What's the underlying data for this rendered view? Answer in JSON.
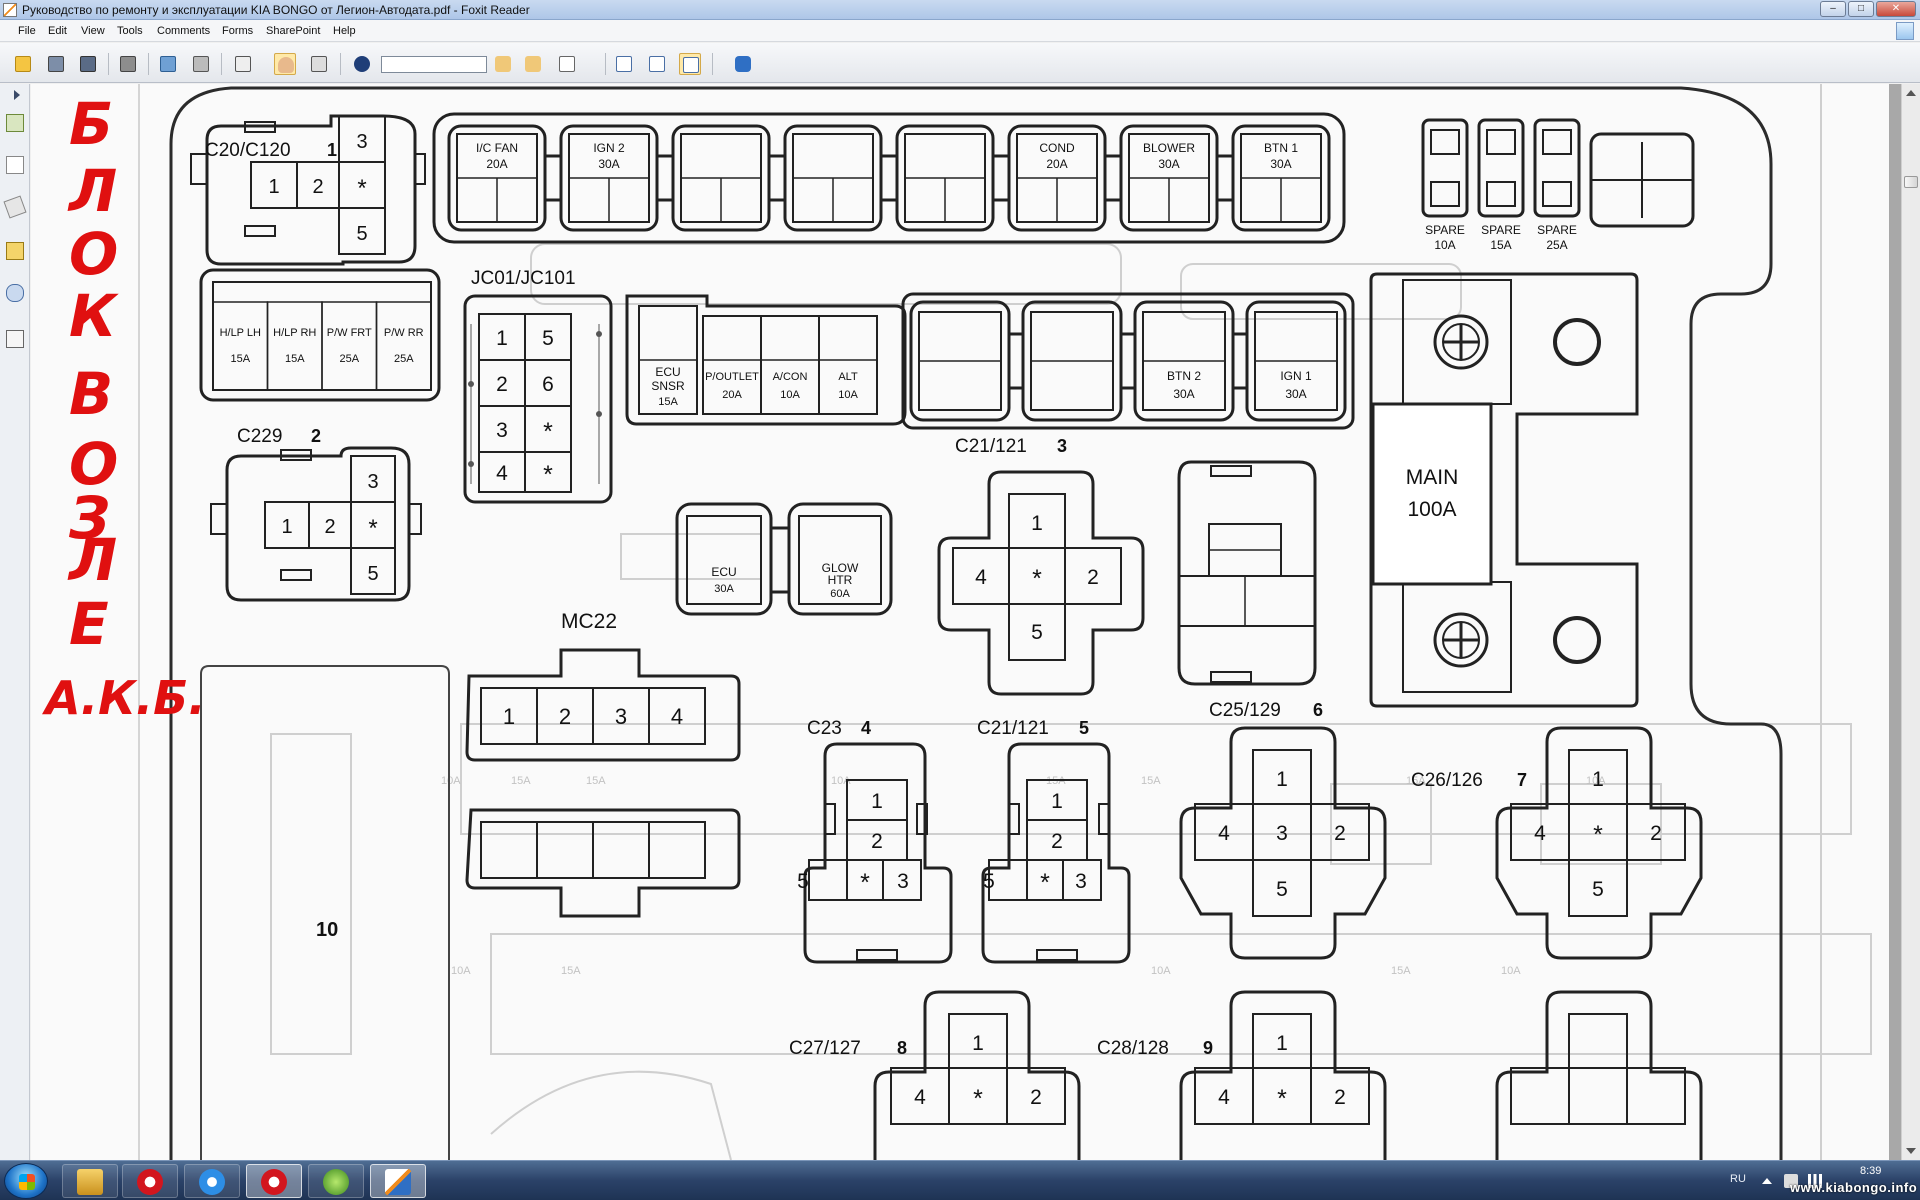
{
  "window": {
    "title": "Руководство по ремонту и эксплуатации KIA BONGO от Легион-Автодата.pdf - Foxit Reader",
    "minimize": "–",
    "maximize": "□",
    "close": "✕"
  },
  "menu": [
    "File",
    "Edit",
    "View",
    "Tools",
    "Comments",
    "Forms",
    "SharePoint",
    "Help"
  ],
  "toolbar": {
    "icons": [
      "open-icon",
      "save-icon",
      "save-as-icon",
      "print-icon",
      "email-icon",
      "scan-icon",
      "select-text-icon",
      "hand-tool-icon",
      "snapshot-icon",
      "find-icon",
      "prev-result-icon",
      "next-result-icon",
      "highlight-icon",
      "fit-page-icon",
      "fit-width-icon",
      "actual-size-icon",
      "rotate-icon"
    ],
    "search_value": ""
  },
  "annotation": {
    "color": "#e01010",
    "lines": [
      "Б",
      "Л",
      "О",
      "К",
      "В",
      "О",
      "З",
      "Л",
      "Е",
      "А.К.Б."
    ]
  },
  "diagram": {
    "connectors": {
      "c20": {
        "label": "C20/C120",
        "num": "1",
        "pins": [
          "3",
          "1",
          "2",
          "*",
          "5"
        ]
      },
      "c229": {
        "label": "C229",
        "num": "2",
        "pins": [
          "3",
          "1",
          "2",
          "*",
          "5"
        ]
      },
      "jc01": {
        "label": "JC01/JC101",
        "pins": [
          "1",
          "5",
          "2",
          "6",
          "3",
          "*",
          "4",
          "*"
        ]
      },
      "c21a": {
        "label": "C21/121",
        "num": "3",
        "pins": [
          "1",
          "4",
          "*",
          "2",
          "5"
        ]
      },
      "mc22": {
        "label": "MC22",
        "pins": [
          "1",
          "2",
          "3",
          "4"
        ]
      },
      "c23": {
        "label": "C23",
        "num": "4",
        "pins": [
          "1",
          "2",
          "5",
          "*",
          "3"
        ]
      },
      "c21b": {
        "label": "C21/121",
        "num": "5",
        "pins": [
          "1",
          "2",
          "5",
          "*",
          "3"
        ]
      },
      "c25": {
        "label": "C25/129",
        "num": "6",
        "pins": [
          "1",
          "4",
          "3",
          "2",
          "5"
        ]
      },
      "c26": {
        "label": "C26/126",
        "num": "7",
        "pins": [
          "1",
          "4",
          "*",
          "2",
          "5"
        ]
      },
      "c27": {
        "label": "C27/127",
        "num": "8",
        "pins": [
          "1",
          "4",
          "*",
          "2"
        ]
      },
      "c28": {
        "label": "C28/128",
        "num": "9",
        "pins": [
          "1",
          "4",
          "*",
          "2"
        ]
      },
      "block10": {
        "label": "10"
      }
    },
    "top_fuses": [
      {
        "name": "I/C FAN",
        "rating": "20A"
      },
      {
        "name": "IGN 2",
        "rating": "30A"
      },
      {
        "name": "",
        "rating": ""
      },
      {
        "name": "",
        "rating": ""
      },
      {
        "name": "",
        "rating": ""
      },
      {
        "name": "COND",
        "rating": "20A"
      },
      {
        "name": "BLOWER",
        "rating": "30A"
      },
      {
        "name": "BTN 1",
        "rating": "30A"
      }
    ],
    "spare": [
      {
        "name": "SPARE",
        "rating": "10A"
      },
      {
        "name": "SPARE",
        "rating": "15A"
      },
      {
        "name": "SPARE",
        "rating": "25A"
      }
    ],
    "left_fuses": [
      {
        "name": "H/LP LH",
        "rating": "15A"
      },
      {
        "name": "H/LP RH",
        "rating": "15A"
      },
      {
        "name": "P/W FRT",
        "rating": "25A"
      },
      {
        "name": "P/W RR",
        "rating": "25A"
      }
    ],
    "mid_fuses": [
      {
        "name": "P/OUTLET",
        "rating": "20A"
      },
      {
        "name": "A/CON",
        "rating": "10A"
      },
      {
        "name": "ALT",
        "rating": "10A"
      }
    ],
    "ecu_snsr": {
      "line1": "ECU",
      "line2": "SNSR",
      "rating": "15A"
    },
    "right_fuses": [
      {
        "name": "",
        "rating": ""
      },
      {
        "name": "",
        "rating": ""
      },
      {
        "name": "BTN 2",
        "rating": "30A"
      },
      {
        "name": "IGN 1",
        "rating": "30A"
      }
    ],
    "ecu": {
      "name": "ECU",
      "rating": "30A"
    },
    "glow": {
      "line1": "GLOW",
      "line2": "HTR",
      "rating": "60A"
    },
    "main": {
      "name": "MAIN",
      "rating": "100A"
    }
  },
  "taskbar": {
    "apps": [
      "explorer-icon",
      "opera-icon",
      "ie-icon",
      "opera-active-icon",
      "network-icon",
      "foxit-icon"
    ],
    "lang": "RU",
    "time": "8:39",
    "watermark": "www.kiabongo.info"
  }
}
